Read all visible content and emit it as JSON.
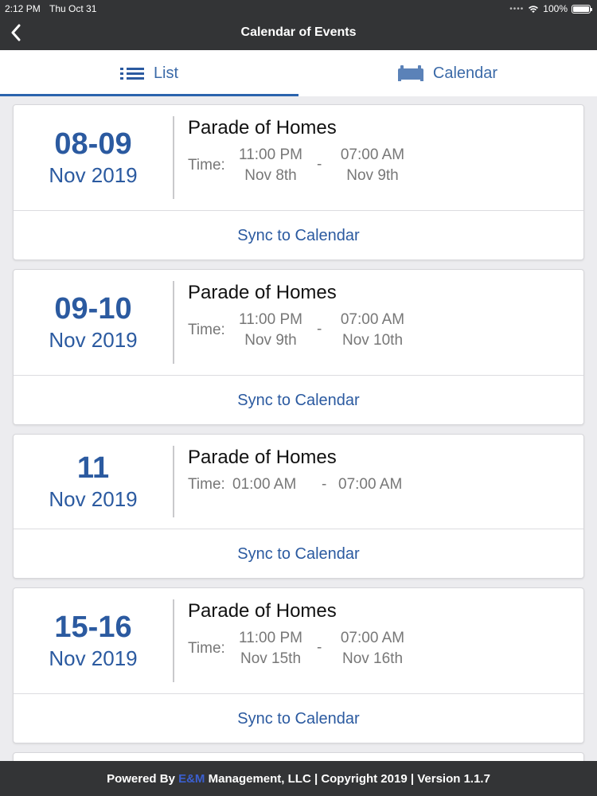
{
  "status_bar": {
    "time": "2:12 PM",
    "date": "Thu Oct 31",
    "battery": "100%"
  },
  "nav": {
    "title": "Calendar of Events"
  },
  "tabs": [
    {
      "label": "List",
      "icon": "list-icon",
      "active": true
    },
    {
      "label": "Calendar",
      "icon": "calendar-bed-icon",
      "active": false
    }
  ],
  "events": [
    {
      "day": "08-09",
      "month": "Nov 2019",
      "title": "Parade of Homes",
      "time_label": "Time:",
      "start_time": "11:00 PM",
      "start_date": "Nov 8th",
      "end_time": "07:00 AM",
      "end_date": "Nov 9th",
      "sync_label": "Sync to Calendar"
    },
    {
      "day": "09-10",
      "month": "Nov 2019",
      "title": "Parade of Homes",
      "time_label": "Time:",
      "start_time": "11:00 PM",
      "start_date": "Nov 9th",
      "end_time": "07:00 AM",
      "end_date": "Nov 10th",
      "sync_label": "Sync to Calendar"
    },
    {
      "day": "11",
      "month": "Nov 2019",
      "title": "Parade of Homes",
      "time_label": "Time:",
      "start_time": "01:00 AM",
      "start_date": "",
      "end_time": "07:00 AM",
      "end_date": "",
      "sync_label": "Sync to Calendar"
    },
    {
      "day": "15-16",
      "month": "Nov 2019",
      "title": "Parade of Homes",
      "time_label": "Time:",
      "start_time": "11:00 PM",
      "start_date": "Nov 15th",
      "end_time": "07:00 AM",
      "end_date": "Nov 16th",
      "sync_label": "Sync to Calendar"
    }
  ],
  "footer": {
    "prefix": "Powered By ",
    "brand": "E&M",
    "suffix": " Management, LLC | Copyright 2019 | Version 1.1.7"
  },
  "colors": {
    "accent": "#2b5aa0",
    "bar": "#333436"
  }
}
